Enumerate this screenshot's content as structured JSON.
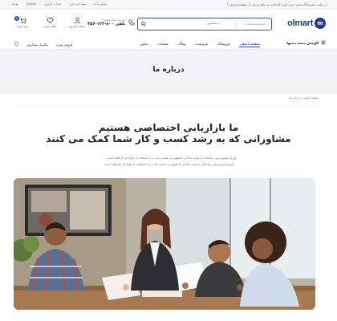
{
  "topbar": {
    "promo": "در سایت فروشگاه پیش خرید نوین اقدامات و نتایج پیروی از صفحه فروش ‌!",
    "links": [
      "تماس با ما",
      "سبد خرید من",
      "حساب کاربری",
      "English",
      "تومان"
    ]
  },
  "header": {
    "logo_text": "olmart",
    "search_placeholder": "جستجو محصولات",
    "search_category": "دسته‌بندی",
    "contact_label": "نیازمند کمک هستید؟",
    "contact_phone": "تلفن ۸۰۰-۱۲۳-۴۵۶",
    "icons": [
      {
        "label": "حساب کاربری",
        "icon": "user-icon"
      },
      {
        "label": "علاقه مندی",
        "icon": "heart-icon"
      },
      {
        "label": "سبد خرید",
        "icon": "cart-icon",
        "badge": "0"
      }
    ]
  },
  "nav": {
    "browse": "آلوچش دسته بندیها",
    "items": [
      "صفحه اصلی",
      "فروشگاه",
      "فروشنده",
      "وبلاگ",
      "صفحات",
      "تماس"
    ],
    "left": [
      "پیگیری سفارش",
      "فروش ویژه"
    ]
  },
  "banner": {
    "title": "درباره ما"
  },
  "breadcrumb": "صفحه اصلی / درباره ما",
  "about": {
    "title_line1": "ما بازاریابی اختصاصی هستیم",
    "title_line2": "مشاورانی که به رشد کسب و کار شما کمک می کنند",
    "para1": "لورم ایپسوم متن ساختگی با تولید سادگی نامفهوم از صنعت چاپ و با استفاده از طراحان گرافیک است . . .",
    "para2": "لورم ایپسوم متن ساختگی با تولید سادگی نامفهوم از صنعت چاپ و با استفاده از طراحان گرافیک است."
  },
  "colors": {
    "accent": "#2855c5",
    "logo": "#1f3a93",
    "banner_bg": "#f3f3f5"
  }
}
